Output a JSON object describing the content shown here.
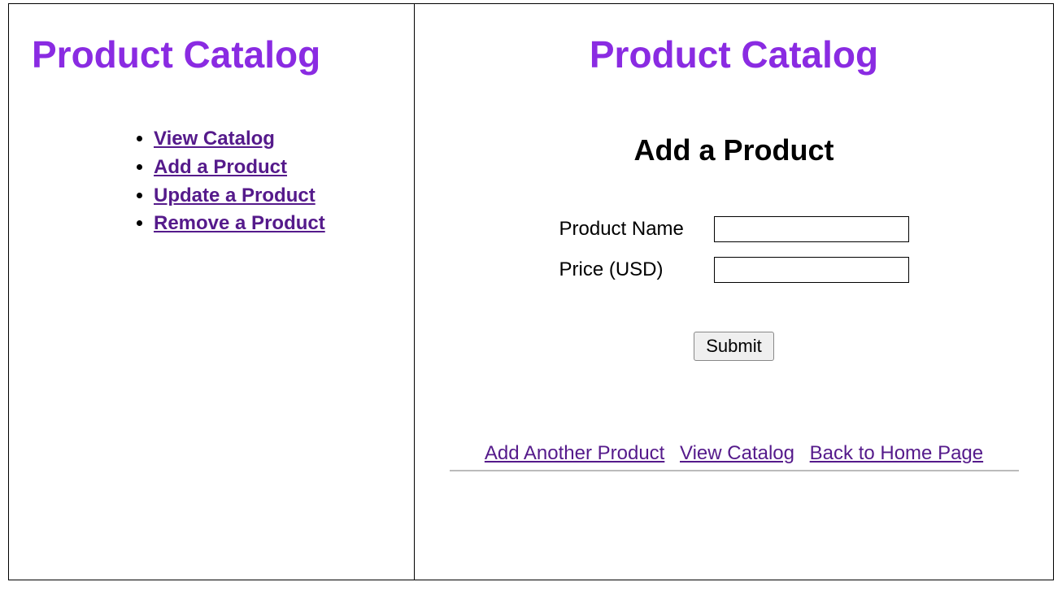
{
  "left": {
    "title": "Product Catalog",
    "nav": [
      "View Catalog",
      "Add a Product",
      "Update a Product",
      "Remove a Product"
    ]
  },
  "right": {
    "title": "Product Catalog",
    "subtitle": "Add a Product",
    "form": {
      "name_label": "Product Name",
      "name_value": "",
      "price_label": "Price (USD)",
      "price_value": "",
      "submit_label": "Submit"
    },
    "links": {
      "add_another": "Add Another Product",
      "view_catalog": "View Catalog",
      "back_home": "Back to Home Page"
    }
  }
}
